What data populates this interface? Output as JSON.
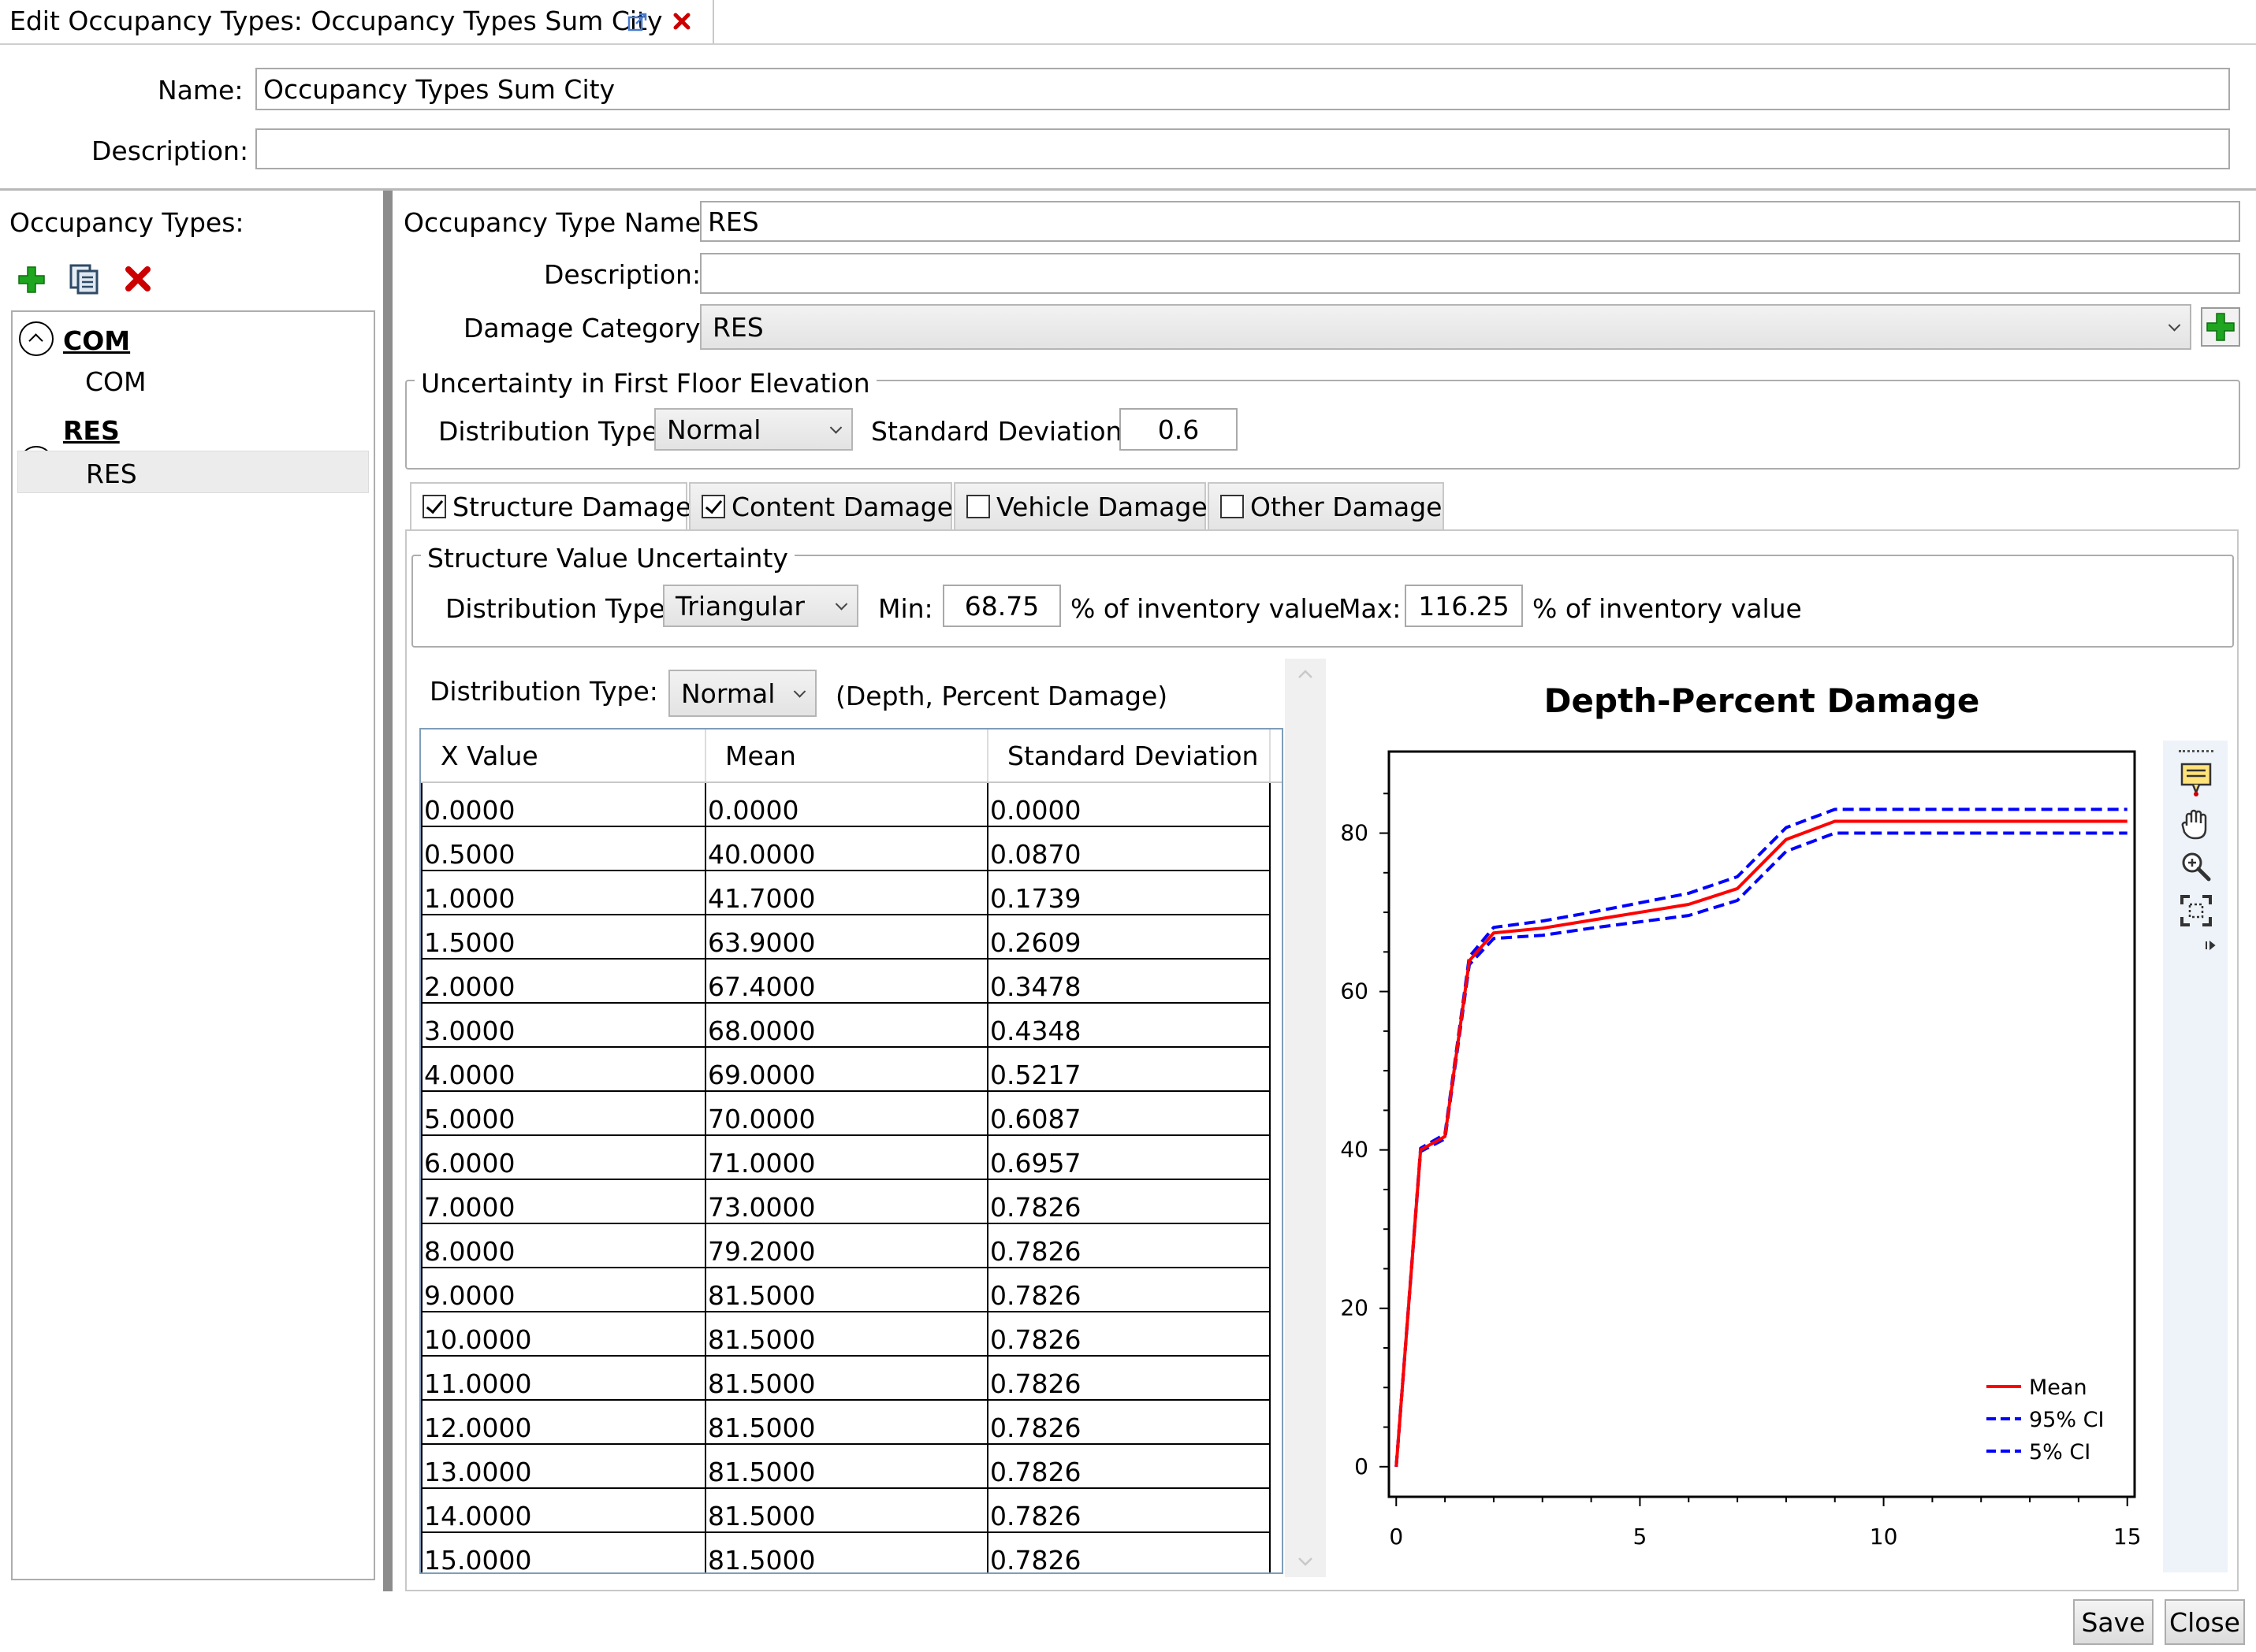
{
  "tab": {
    "title": "Edit Occupancy Types: Occupancy Types Sum City"
  },
  "top": {
    "name_label": "Name:",
    "name_value": "Occupancy Types Sum City",
    "description_label": "Description:",
    "description_value": ""
  },
  "left": {
    "header": "Occupancy Types:",
    "groups": [
      {
        "label": "COM",
        "items": [
          "COM"
        ]
      },
      {
        "label": "RES",
        "items": [
          "RES"
        ]
      }
    ]
  },
  "detail": {
    "occ_name_label": "Occupancy Type Name:",
    "occ_name_value": "RES",
    "description_label": "Description:",
    "description_value": "",
    "damcat_label": "Damage Category:",
    "damcat_value": "RES",
    "ffe": {
      "title": "Uncertainty in First Floor Elevation",
      "dist_label": "Distribution Type",
      "dist_value": "Normal",
      "std_label": "Standard Deviation:",
      "std_value": "0.6"
    },
    "tabs": [
      {
        "label": "Structure Damage",
        "checked": true
      },
      {
        "label": "Content Damage",
        "checked": true
      },
      {
        "label": "Vehicle Damage",
        "checked": false
      },
      {
        "label": "Other Damage",
        "checked": false
      }
    ],
    "svu": {
      "title": "Structure Value Uncertainty",
      "dist_label": "Distribution Type",
      "dist_value": "Triangular",
      "min_label": "Min:",
      "min_value": "68.75",
      "pct1": "% of inventory value",
      "max_label": "Max:",
      "max_value": "116.25",
      "pct2": "% of inventory value"
    },
    "curve": {
      "dist_label": "Distribution Type:",
      "dist_value": "Normal",
      "dist_note": "(Depth, Percent Damage)",
      "columns": [
        "X Value",
        "Mean",
        "Standard Deviation"
      ],
      "rows": [
        [
          "0.0000",
          "0.0000",
          "0.0000"
        ],
        [
          "0.5000",
          "40.0000",
          "0.0870"
        ],
        [
          "1.0000",
          "41.7000",
          "0.1739"
        ],
        [
          "1.5000",
          "63.9000",
          "0.2609"
        ],
        [
          "2.0000",
          "67.4000",
          "0.3478"
        ],
        [
          "3.0000",
          "68.0000",
          "0.4348"
        ],
        [
          "4.0000",
          "69.0000",
          "0.5217"
        ],
        [
          "5.0000",
          "70.0000",
          "0.6087"
        ],
        [
          "6.0000",
          "71.0000",
          "0.6957"
        ],
        [
          "7.0000",
          "73.0000",
          "0.7826"
        ],
        [
          "8.0000",
          "79.2000",
          "0.7826"
        ],
        [
          "9.0000",
          "81.5000",
          "0.7826"
        ],
        [
          "10.0000",
          "81.5000",
          "0.7826"
        ],
        [
          "11.0000",
          "81.5000",
          "0.7826"
        ],
        [
          "12.0000",
          "81.5000",
          "0.7826"
        ],
        [
          "13.0000",
          "81.5000",
          "0.7826"
        ],
        [
          "14.0000",
          "81.5000",
          "0.7826"
        ],
        [
          "15.0000",
          "81.5000",
          "0.7826"
        ]
      ]
    }
  },
  "buttons": {
    "save": "Save",
    "close": "Close"
  },
  "icons": {
    "add": "plus-icon",
    "copy": "copy-icon",
    "delete": "delete-icon",
    "popout": "popout-icon",
    "close_tab": "close-icon",
    "annotate": "annotation-icon",
    "pan": "pan-hand-icon",
    "zoom": "zoom-icon",
    "fit": "fit-extent-icon"
  },
  "colors": {
    "mean": "#ff0000",
    "ci": "#0000ff",
    "plus": "#1fa51f",
    "delete": "#cc0000"
  },
  "chart_data": {
    "type": "line",
    "title": "Depth-Percent Damage",
    "xlabel": "",
    "ylabel": "",
    "xlim": [
      0,
      15
    ],
    "ylim": [
      0,
      80
    ],
    "xticks": [
      "0",
      "5",
      "10",
      "15"
    ],
    "yticks": [
      "0",
      "20",
      "40",
      "60",
      "80"
    ],
    "legend_position": "bottom-right",
    "x": [
      0,
      0.5,
      1,
      1.5,
      2,
      3,
      4,
      5,
      6,
      7,
      8,
      9,
      10,
      11,
      12,
      13,
      14,
      15
    ],
    "series": [
      {
        "name": "Mean",
        "style": "solid",
        "color": "#ff0000",
        "values": [
          0,
          40,
          41.7,
          63.9,
          67.4,
          68,
          69,
          70,
          71,
          73,
          79.2,
          81.5,
          81.5,
          81.5,
          81.5,
          81.5,
          81.5,
          81.5
        ]
      },
      {
        "name": "95% CI",
        "style": "dashed",
        "color": "#0000ff",
        "values": [
          0,
          40.2,
          42,
          64.4,
          68.1,
          68.9,
          70,
          71.2,
          72.4,
          74.5,
          80.7,
          83,
          83,
          83,
          83,
          83,
          83,
          83
        ]
      },
      {
        "name": "5% CI",
        "style": "dashed",
        "color": "#0000ff",
        "values": [
          0,
          39.8,
          41.4,
          63.4,
          66.7,
          67.1,
          68,
          68.8,
          69.6,
          71.5,
          77.7,
          80,
          80,
          80,
          80,
          80,
          80,
          80
        ]
      }
    ]
  }
}
